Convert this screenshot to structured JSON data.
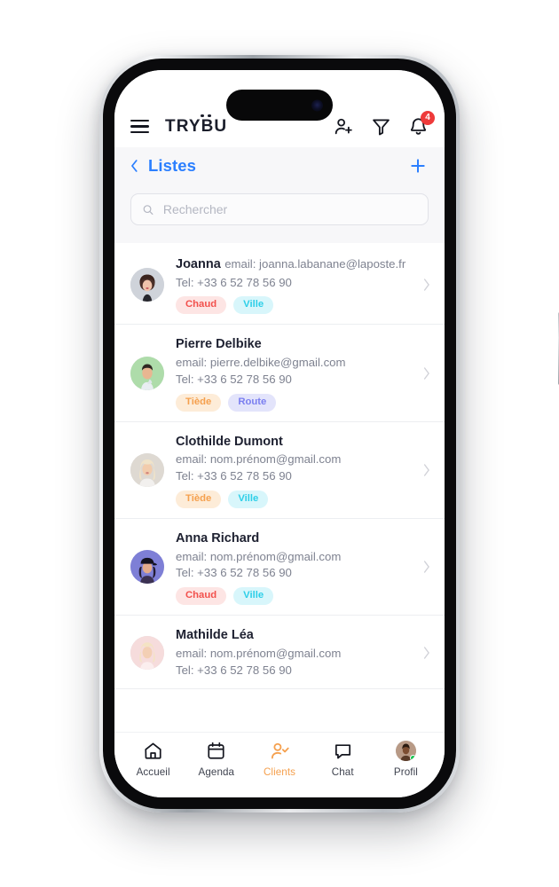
{
  "app": {
    "brand": "TRYBU",
    "brand_main": "TR",
    "brand_y": "Y",
    "brand_tail": "BU"
  },
  "topbar": {
    "menu_icon": "hamburger-menu-icon",
    "add_person_icon": "person-add-icon",
    "filter_icon": "filter-funnel-icon",
    "bell_icon": "bell-icon",
    "notification_count": "4",
    "badge_color": "#ee3a3a"
  },
  "page_header": {
    "back_icon": "chevron-left-icon",
    "title": "Listes",
    "add_icon": "plus-icon",
    "accent_color": "#2b7fff"
  },
  "search": {
    "icon": "search-icon",
    "placeholder": "Rechercher",
    "value": ""
  },
  "contacts": [
    {
      "name": "Joanna",
      "email": "email: joanna.labanane@laposte.fr",
      "phone": "Tel: +33 6 52 78 56 90",
      "avatar": "avatar-joanna",
      "avatar_bg": "#cfd3da",
      "tags": [
        {
          "label": "Chaud",
          "color": "#f2504c",
          "bg": "#fde5e4"
        },
        {
          "label": "Ville",
          "color": "#2ecfe8",
          "bg": "#d8f6fb"
        }
      ]
    },
    {
      "name": "Pierre Delbike",
      "email": "email: pierre.delbike@gmail.com",
      "phone": "Tel: +33 6 52 78 56 90",
      "avatar": "avatar-pierre",
      "avatar_bg": "#aedcaa",
      "tags": [
        {
          "label": "Tiède",
          "color": "#f5a04e",
          "bg": "#fdecd8"
        },
        {
          "label": "Route",
          "color": "#7b7ff0",
          "bg": "#e3e4fb"
        }
      ]
    },
    {
      "name": "Clothilde Dumont",
      "email": "email: nom.prénom@gmail.com",
      "phone": "Tel: +33 6 52 78 56 90",
      "avatar": "avatar-clothilde",
      "avatar_bg": "#ded9d2",
      "tags": [
        {
          "label": "Tiède",
          "color": "#f5a04e",
          "bg": "#fdecd8"
        },
        {
          "label": "Ville",
          "color": "#2ecfe8",
          "bg": "#d8f6fb"
        }
      ]
    },
    {
      "name": "Anna Richard",
      "email": "email: nom.prénom@gmail.com",
      "phone": "Tel: +33 6 52 78 56 90",
      "avatar": "avatar-anna",
      "avatar_bg": "#7e7fd6",
      "tags": [
        {
          "label": "Chaud",
          "color": "#f2504c",
          "bg": "#fde5e4"
        },
        {
          "label": "Ville",
          "color": "#2ecfe8",
          "bg": "#d8f6fb"
        }
      ]
    },
    {
      "name": "Mathilde Léa",
      "email": "email: nom.prénom@gmail.com",
      "phone": "Tel: +33 6 52 78 56 90",
      "avatar": "avatar-mathilde",
      "avatar_bg": "#f6dcdc",
      "tags": []
    }
  ],
  "row_chevron_icon": "chevron-right-icon",
  "tabbar": {
    "active_color": "#f5a04e",
    "items": [
      {
        "label": "Accueil",
        "icon": "home-icon",
        "active": false
      },
      {
        "label": "Agenda",
        "icon": "calendar-icon",
        "active": false
      },
      {
        "label": "Clients",
        "icon": "person-check-icon",
        "active": true
      },
      {
        "label": "Chat",
        "icon": "chat-bubble-icon",
        "active": false
      },
      {
        "label": "Profil",
        "icon": "profile-avatar-icon",
        "active": false
      }
    ]
  }
}
